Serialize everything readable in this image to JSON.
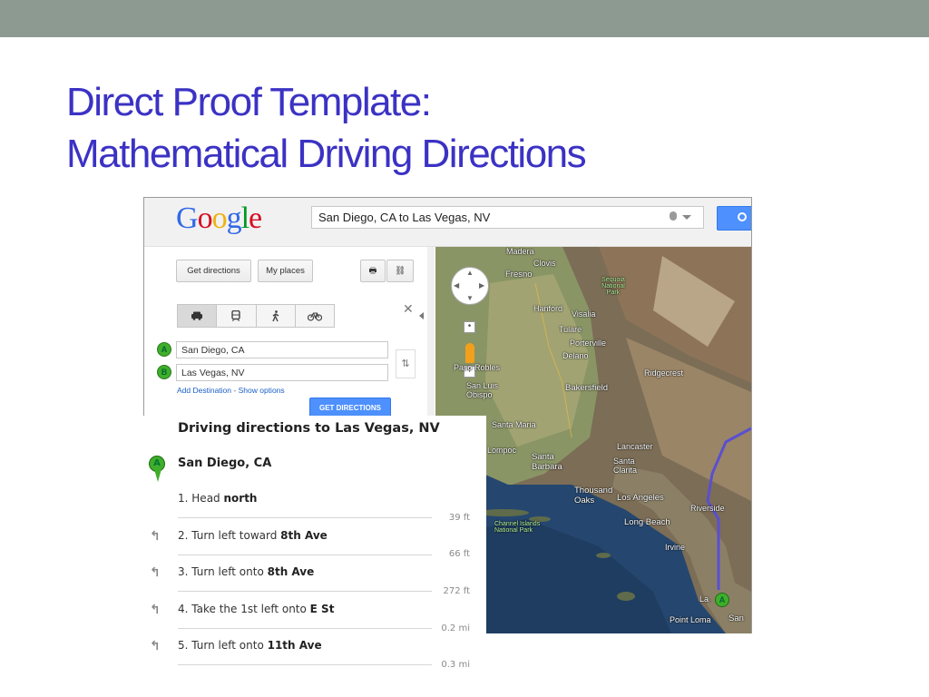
{
  "slide": {
    "title_line1": "Direct Proof Template:",
    "title_line2": "Mathematical Driving Directions"
  },
  "google": {
    "logo": [
      "G",
      "o",
      "o",
      "g",
      "l",
      "e"
    ],
    "logo_colors": [
      "#3369e8",
      "#d50f25",
      "#eeb211",
      "#3369e8",
      "#009925",
      "#d50f25"
    ],
    "search_query": "San Diego, CA to Las Vegas, NV"
  },
  "panel": {
    "get_directions_btn": "Get directions",
    "my_places_btn": "My places",
    "print_icon": "🖶",
    "link_icon": "⛓",
    "modes": [
      "car-icon",
      "transit-icon",
      "walk-icon",
      "bike-icon"
    ],
    "close": "✕",
    "origin_marker": "A",
    "origin_value": "San Diego, CA",
    "dest_marker": "B",
    "dest_value": "Las Vegas, NV",
    "swap": "⇅",
    "add_destination": "Add Destination",
    "separator": "-",
    "show_options": "Show options",
    "submit": "GET DIRECTIONS"
  },
  "map": {
    "labels": [
      {
        "name": "Madera"
      },
      {
        "name": "Clovis"
      },
      {
        "name": "Fresno"
      },
      {
        "name": "Sequoia National Park"
      },
      {
        "name": "Hanford"
      },
      {
        "name": "Visalia"
      },
      {
        "name": "Tulare"
      },
      {
        "name": "Porterville"
      },
      {
        "name": "Delano"
      },
      {
        "name": "Paso Robles"
      },
      {
        "name": "Bakersfield"
      },
      {
        "name": "Ridgecrest"
      },
      {
        "name": "San Luis Obispo"
      },
      {
        "name": "Santa Maria"
      },
      {
        "name": "Lompoc"
      },
      {
        "name": "Lancaster"
      },
      {
        "name": "Santa Barbara"
      },
      {
        "name": "Santa Clarita"
      },
      {
        "name": "Thousand Oaks"
      },
      {
        "name": "Los Angeles"
      },
      {
        "name": "Riverside"
      },
      {
        "name": "Long Beach"
      },
      {
        "name": "Channel Islands National Park"
      },
      {
        "name": "Irvine"
      },
      {
        "name": "La Jolla"
      },
      {
        "name": "Point Loma"
      },
      {
        "name": "San"
      }
    ],
    "marker": "A"
  },
  "directions": {
    "title": "Driving directions to Las Vegas, NV",
    "origin_marker": "A",
    "origin": "San Diego, CA",
    "turn_icon": "↰",
    "steps": [
      {
        "num": "1.",
        "pre": "Head ",
        "bold": "north",
        "post": "",
        "dist": "39 ft"
      },
      {
        "num": "2.",
        "pre": "Turn left toward ",
        "bold": "8th Ave",
        "post": "",
        "dist": "66 ft"
      },
      {
        "num": "3.",
        "pre": "Turn left onto ",
        "bold": "8th Ave",
        "post": "",
        "dist": "272 ft"
      },
      {
        "num": "4.",
        "pre": "Take the 1st left onto ",
        "bold": "E St",
        "post": "",
        "dist": "0.2 mi"
      },
      {
        "num": "5.",
        "pre": "Turn left onto ",
        "bold": "11th Ave",
        "post": "",
        "dist": "0.3 mi"
      }
    ]
  }
}
